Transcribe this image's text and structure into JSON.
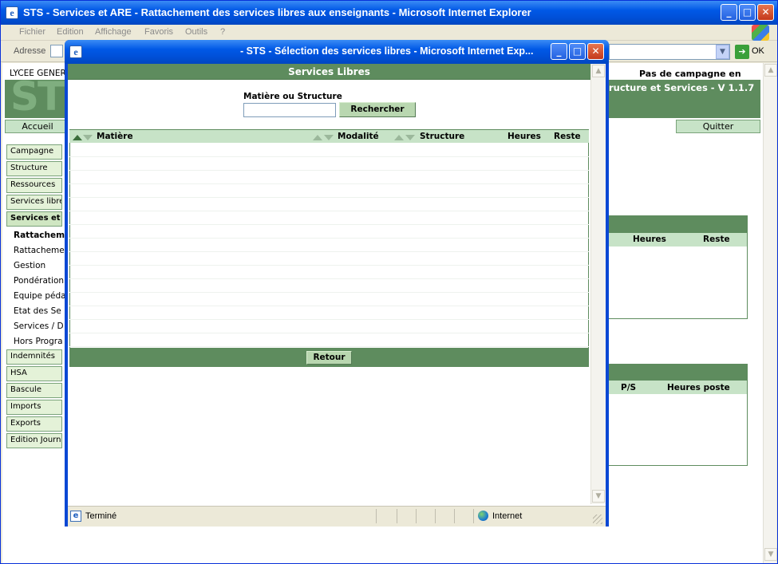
{
  "main_window": {
    "title": "STS - Services et ARE - Rattachement des services libres aux enseignants - Microsoft Internet Explorer",
    "menu": [
      "Fichier",
      "Edition",
      "Affichage",
      "Favoris",
      "Outils",
      "?"
    ],
    "address_label": "Adresse",
    "go_label": "OK",
    "school": "LYCEE GENER",
    "campaign_status": "Pas de campagne en cours",
    "app_title": "ructure et Services - V 1.1.7",
    "logo_text": "ST",
    "tabs": {
      "home": "Accueil",
      "quit": "Quitter"
    },
    "nav": [
      "Campagne",
      "Structure",
      "Ressources",
      "Services libre",
      "Services et A"
    ],
    "sub_nav": [
      "Rattacheme",
      "Rattacheme",
      "Gestion",
      "Pondération",
      "Equipe péda",
      "Etat des Se",
      "Services / D",
      "Hors Progra"
    ],
    "nav_bottom": [
      "Indemnités",
      "HSA",
      "Bascule",
      "Imports",
      "Exports",
      "Edition Journ"
    ],
    "table1_headers": [
      "Heures",
      "Reste"
    ],
    "table2_headers": [
      "P/S",
      "Heures poste"
    ]
  },
  "popup": {
    "title": "- STS - Sélection des services libres - Microsoft Internet Exp...",
    "header": "Services Libres",
    "search_label": "Matière ou Structure",
    "search_value": "",
    "search_button": "Rechercher",
    "columns": [
      "Matière",
      "Modalité",
      "Structure",
      "Heures",
      "Reste"
    ],
    "back_button": "Retour",
    "status_text": "Terminé",
    "zone": "Internet"
  }
}
